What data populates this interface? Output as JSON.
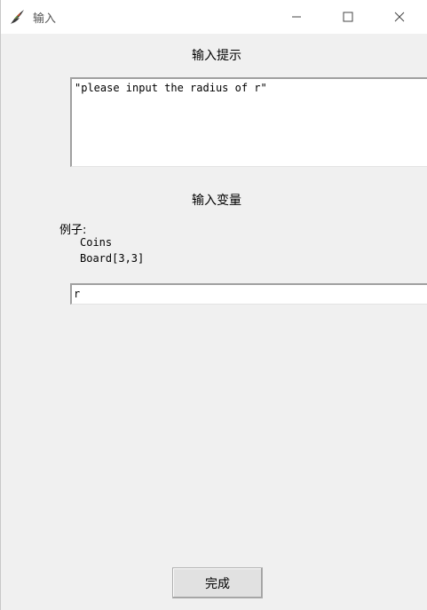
{
  "window": {
    "title": "输入"
  },
  "hint": {
    "label": "输入提示",
    "text": "\"please input the radius of r\""
  },
  "variable": {
    "label": "输入变量",
    "example_title": "例子:",
    "examples": [
      "Coins",
      "Board[3,3]"
    ],
    "value": "r"
  },
  "footer": {
    "done_label": "完成"
  }
}
